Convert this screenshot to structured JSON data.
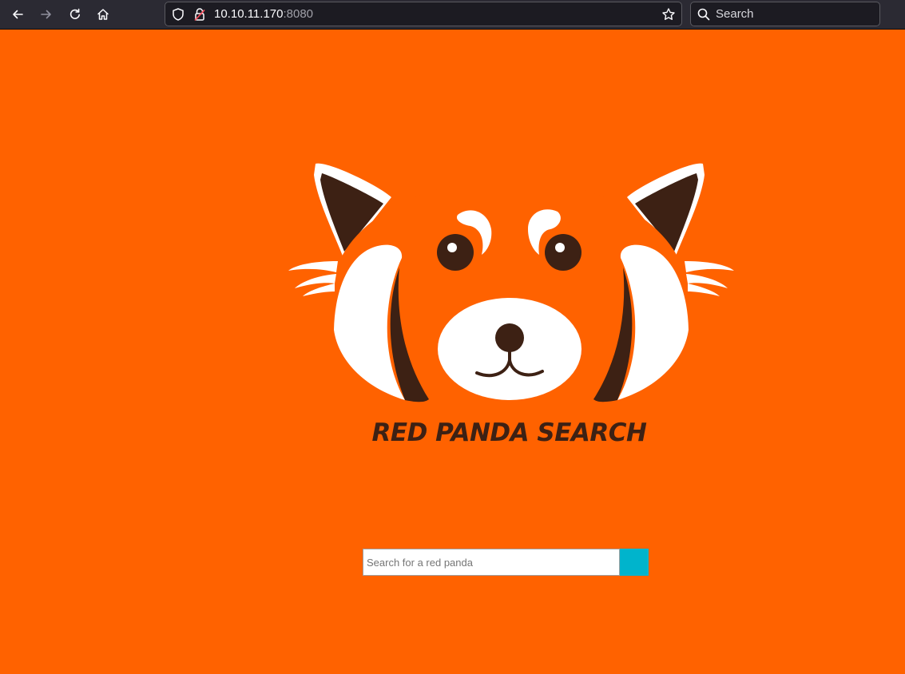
{
  "browser": {
    "url_host": "10.10.11.170",
    "url_port": ":8080",
    "search_placeholder": "Search"
  },
  "page": {
    "title": "RED PANDA SEARCH",
    "search": {
      "placeholder": "Search for a red panda",
      "value": ""
    }
  },
  "colors": {
    "background": "#ff6200",
    "panda_dark": "#3d2114",
    "button": "#00b4cc"
  }
}
